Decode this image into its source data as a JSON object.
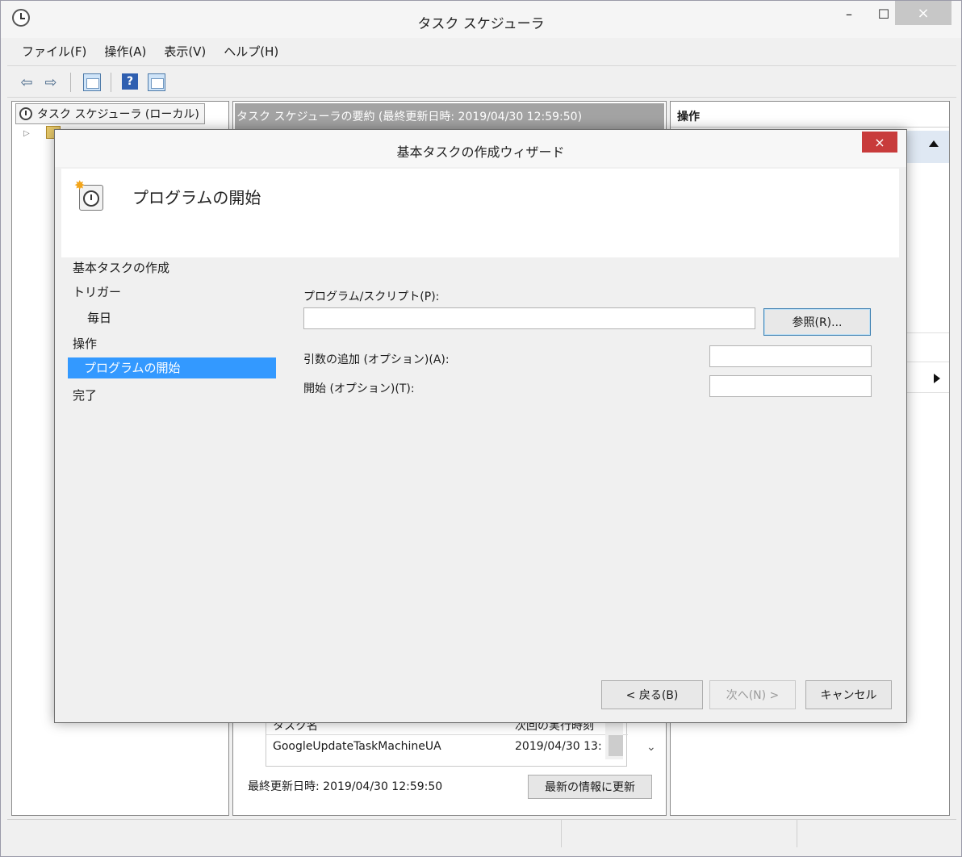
{
  "window": {
    "title": "タスク スケジューラ",
    "min_label": "–",
    "max_label": "☐",
    "close_label": "×"
  },
  "menu": [
    "ファイル(F)",
    "操作(A)",
    "表示(V)",
    "ヘルプ(H)"
  ],
  "toolbar": {
    "back_icon": "⇦",
    "forward_icon": "⇨",
    "help_label": "?"
  },
  "tree": {
    "root_label": "タスク スケジューラ (ローカル)",
    "expander": "▷"
  },
  "center": {
    "summary_title": "タスク スケジューラの要約 (最終更新日時: 2019/04/30 12:59:50)",
    "list_headers": [
      "タスク名",
      "次回の実行時刻"
    ],
    "list_rows": [
      {
        "name": "GoogleUpdateTaskMachineUA",
        "next_run": "2019/04/30 13:"
      }
    ],
    "scroll_down_icon": "⌄",
    "last_update": "最終更新日時: 2019/04/30 12:59:50",
    "refresh_label": "最新の情報に更新"
  },
  "actions": {
    "header": "操作"
  },
  "dialog": {
    "title": "基本タスクの作成ウィザード",
    "close_label": "×",
    "header_title": "プログラムの開始",
    "steps": {
      "create": "基本タスクの作成",
      "trigger": "トリガー",
      "daily": "毎日",
      "action": "操作",
      "start_program": "プログラムの開始",
      "finish": "完了"
    },
    "program_label": "プログラム/スクリプト(P):",
    "program_value": "",
    "browse_label": "参照(R)...",
    "args_label": "引数の追加 (オプション)(A):",
    "args_value": "",
    "start_in_label": "開始 (オプション)(T):",
    "start_in_value": "",
    "back_label": "< 戻る(B)",
    "next_label": "次へ(N) >",
    "cancel_label": "キャンセル"
  }
}
